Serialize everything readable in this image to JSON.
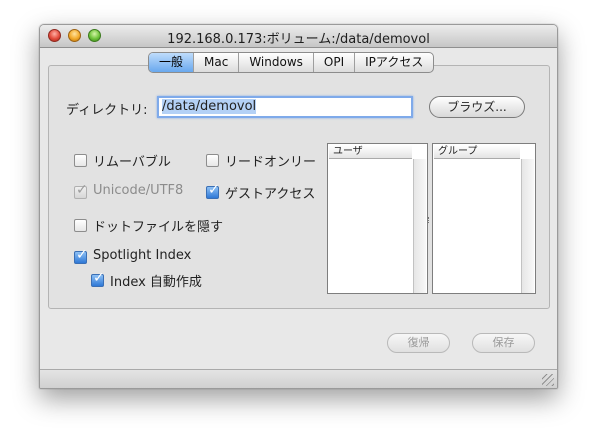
{
  "window": {
    "title": "192.168.0.173:ボリューム:/data/demovol"
  },
  "tabs": [
    {
      "label": "一般",
      "active": true
    },
    {
      "label": "Mac",
      "active": false
    },
    {
      "label": "Windows",
      "active": false
    },
    {
      "label": "OPI",
      "active": false
    },
    {
      "label": "IPアクセス",
      "active": false
    }
  ],
  "directory": {
    "label": "ディレクトリ:",
    "value": "/data/demovol",
    "browse_label": "ブラウズ..."
  },
  "options": {
    "removable": {
      "label": "リムーバブル",
      "checked": false
    },
    "readonly": {
      "label": "リードオンリー",
      "checked": false
    },
    "unicode": {
      "label": "Unicode/UTF8",
      "checked": true,
      "enabled": false
    },
    "guest": {
      "label": "ゲストアクセス",
      "checked": true
    },
    "hide_dot": {
      "label": "ドットファイルを隠す",
      "checked": false
    },
    "spotlight": {
      "label": "Spotlight Index",
      "checked": true
    },
    "auto_index": {
      "label": "Index 自動作成",
      "checked": true
    }
  },
  "lists": {
    "users_header": "ユーザ",
    "groups_header": "グループ"
  },
  "buttons": {
    "revert_label": "復帰",
    "save_label": "保存"
  },
  "colors": {
    "accent": "#3a7bd5",
    "selection": "#b4d1f6"
  }
}
